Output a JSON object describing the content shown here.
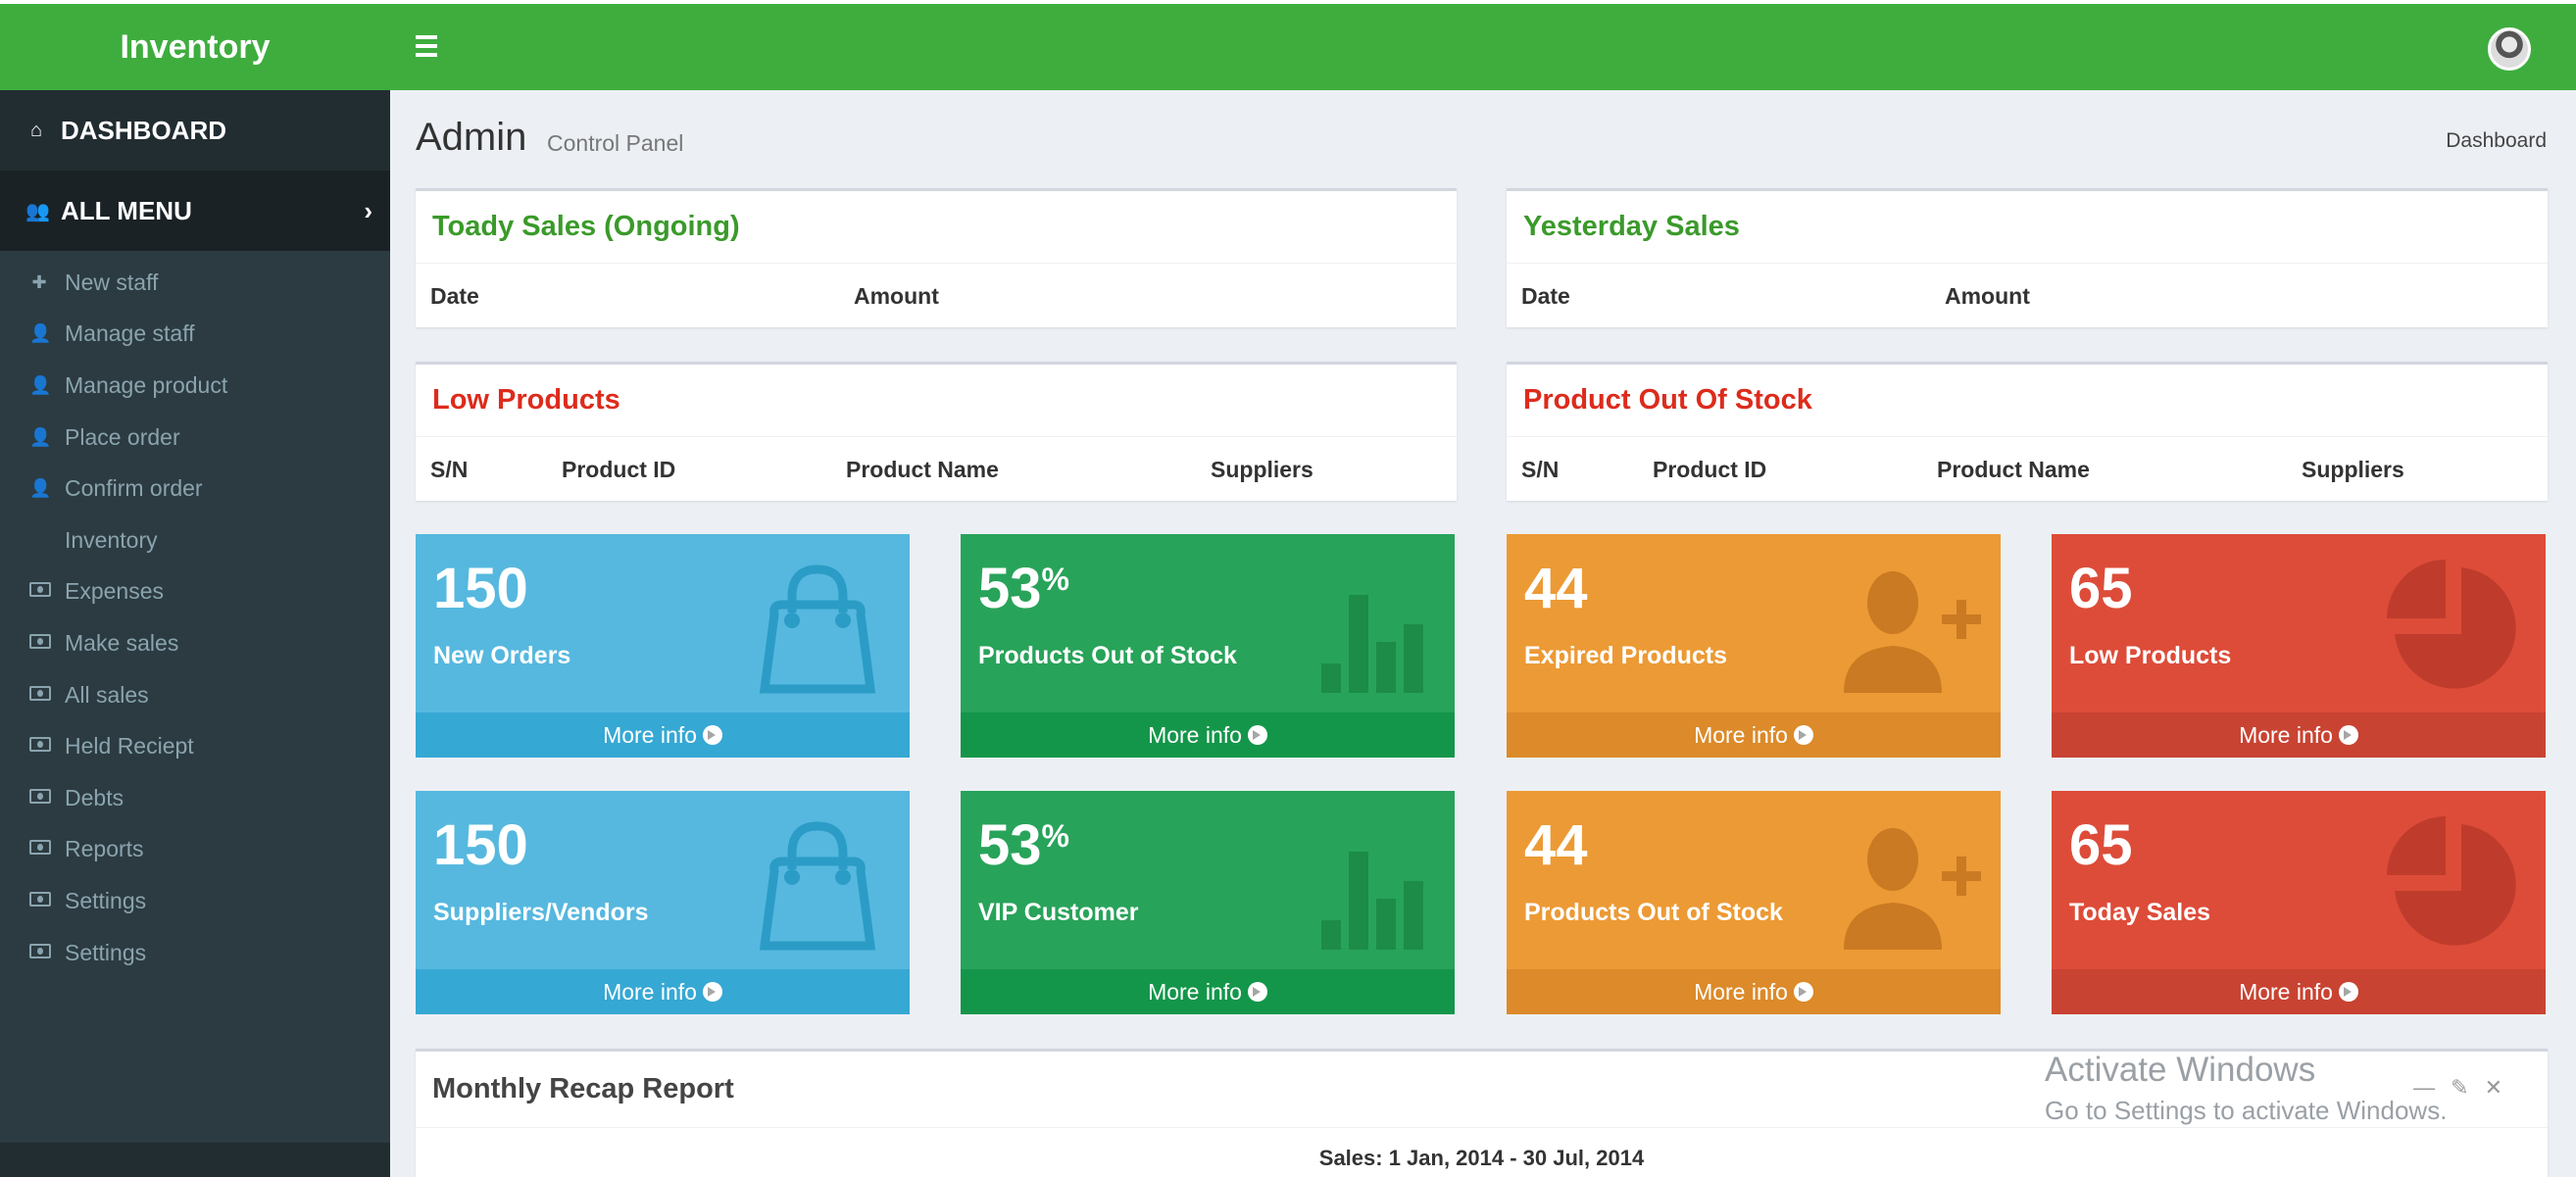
{
  "app": {
    "brand": "Inventory"
  },
  "sidebar": {
    "dashboard": "DASHBOARD",
    "all_menu": "ALL MENU",
    "items": [
      {
        "label": "New staff",
        "icon": "plus-icon"
      },
      {
        "label": "Manage staff",
        "icon": "user-icon"
      },
      {
        "label": "Manage product",
        "icon": "user-icon"
      },
      {
        "label": "Place order",
        "icon": "user-icon"
      },
      {
        "label": "Confirm order",
        "icon": "user-icon"
      },
      {
        "label": "Inventory",
        "icon": ""
      },
      {
        "label": "Expenses",
        "icon": "money-icon"
      },
      {
        "label": "Make sales",
        "icon": "money-icon"
      },
      {
        "label": "All sales",
        "icon": "money-icon"
      },
      {
        "label": "Held Reciept",
        "icon": "money-icon"
      },
      {
        "label": "Debts",
        "icon": "money-icon"
      },
      {
        "label": "Reports",
        "icon": "money-icon"
      },
      {
        "label": "Settings",
        "icon": "money-icon"
      },
      {
        "label": "Settings",
        "icon": "money-icon"
      }
    ]
  },
  "header": {
    "title": "Admin",
    "subtitle": "Control Panel",
    "breadcrumb": "Dashboard"
  },
  "today_sales": {
    "title": "Toady Sales (Ongoing)",
    "columns": [
      "Date",
      "Amount"
    ]
  },
  "yesterday_sales": {
    "title": "Yesterday Sales",
    "columns": [
      "Date",
      "Amount"
    ]
  },
  "low_products": {
    "title": "Low Products",
    "columns": [
      "S/N",
      "Product ID",
      "Product Name",
      "Suppliers"
    ]
  },
  "out_of_stock": {
    "title": "Product Out Of Stock",
    "columns": [
      "S/N",
      "Product ID",
      "Product Name",
      "Suppliers"
    ]
  },
  "tiles": [
    {
      "value": "150",
      "suffix": "",
      "label": "New Orders",
      "footer": "More info",
      "color": "#56b8df",
      "icon": "shopping-bag-icon"
    },
    {
      "value": "53",
      "suffix": "%",
      "label": "Products Out of Stock",
      "footer": "More info",
      "color": "#28a35a",
      "icon": "bar-chart-icon"
    },
    {
      "value": "44",
      "suffix": "",
      "label": "Expired Products",
      "footer": "More info",
      "color": "#ec9a35",
      "icon": "user-add-icon"
    },
    {
      "value": "65",
      "suffix": "",
      "label": "Low Products",
      "footer": "More info",
      "color": "#dd4c39",
      "icon": "pie-chart-icon"
    },
    {
      "value": "150",
      "suffix": "",
      "label": "Suppliers/Vendors",
      "footer": "More info",
      "color": "#56b8df",
      "icon": "shopping-bag-icon"
    },
    {
      "value": "53",
      "suffix": "%",
      "label": "VIP Customer",
      "footer": "More info",
      "color": "#28a35a",
      "icon": "bar-chart-icon"
    },
    {
      "value": "44",
      "suffix": "",
      "label": "Products Out of Stock",
      "footer": "More info",
      "color": "#ec9a35",
      "icon": "user-add-icon"
    },
    {
      "value": "65",
      "suffix": "",
      "label": "Today Sales",
      "footer": "More info",
      "color": "#dd4c39",
      "icon": "pie-chart-icon"
    }
  ],
  "recap": {
    "title": "Monthly Recap Report",
    "subtitle": "Sales: 1 Jan, 2014 - 30 Jul, 2014"
  },
  "watermark": {
    "line1": "Activate Windows",
    "line2": "Go to Settings to activate Windows."
  }
}
